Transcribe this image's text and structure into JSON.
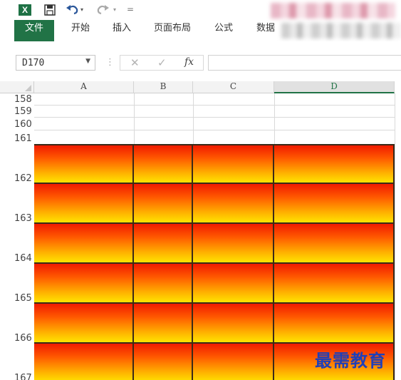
{
  "qat": {
    "app_icon": "X",
    "icons": [
      "excel-logo",
      "save-icon",
      "undo-icon",
      "redo-icon"
    ],
    "customize": "="
  },
  "ribbon": {
    "tabs": [
      {
        "label": "文件"
      },
      {
        "label": "开始"
      },
      {
        "label": "插入"
      },
      {
        "label": "页面布局"
      },
      {
        "label": "公式"
      },
      {
        "label": "数据"
      }
    ]
  },
  "formula_bar": {
    "name_box": "D170",
    "fx_label": "fx",
    "value": ""
  },
  "sheet": {
    "columns": [
      {
        "label": "A",
        "selected": false
      },
      {
        "label": "B",
        "selected": false
      },
      {
        "label": "C",
        "selected": false
      },
      {
        "label": "D",
        "selected": true
      }
    ],
    "rows": [
      {
        "label": "158",
        "filled": false
      },
      {
        "label": "159",
        "filled": false
      },
      {
        "label": "160",
        "filled": false
      },
      {
        "label": "161",
        "filled": false
      },
      {
        "label": "162",
        "filled": true
      },
      {
        "label": "163",
        "filled": true
      },
      {
        "label": "164",
        "filled": true
      },
      {
        "label": "165",
        "filled": true
      },
      {
        "label": "166",
        "filled": true
      },
      {
        "label": "167",
        "filled": true
      }
    ],
    "fill_colors": [
      "#f01a00",
      "#ffe400"
    ]
  },
  "watermark": "最需教育"
}
